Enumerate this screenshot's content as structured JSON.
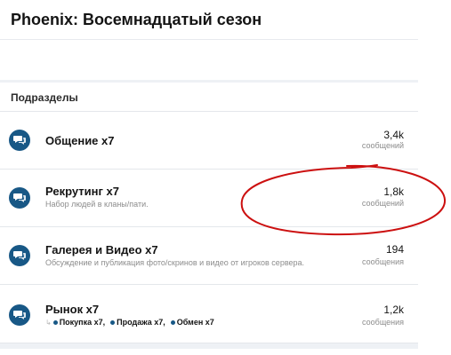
{
  "page": {
    "title": "Phoenix: Восемнадцатый сезон"
  },
  "section": {
    "title": "Подразделы"
  },
  "nodes": [
    {
      "title": "Общение x7",
      "description": "",
      "stat_value": "3,4k",
      "stat_label": "сообщений",
      "icon": "comments-icon"
    },
    {
      "title": "Рекрутинг x7",
      "description": "Набор людей в кланы/пати.",
      "stat_value": "1,8k",
      "stat_label": "сообщений",
      "icon": "comments-icon"
    },
    {
      "title": "Галерея и Видео x7",
      "description": "Обсуждение и публикация фото/скринов и видео от игроков сервера.",
      "stat_value": "194",
      "stat_label": "сообщения",
      "icon": "comments-icon"
    },
    {
      "title": "Рынок x7",
      "description": "",
      "stat_value": "1,2k",
      "stat_label": "сообщения",
      "icon": "comments-icon",
      "subforums": [
        "Покупка x7,",
        "Продажа x7,",
        "Обмен x7"
      ]
    }
  ],
  "colors": {
    "icon_bg": "#185886",
    "annotation": "#cc1010",
    "divider": "#e4e7eb"
  }
}
